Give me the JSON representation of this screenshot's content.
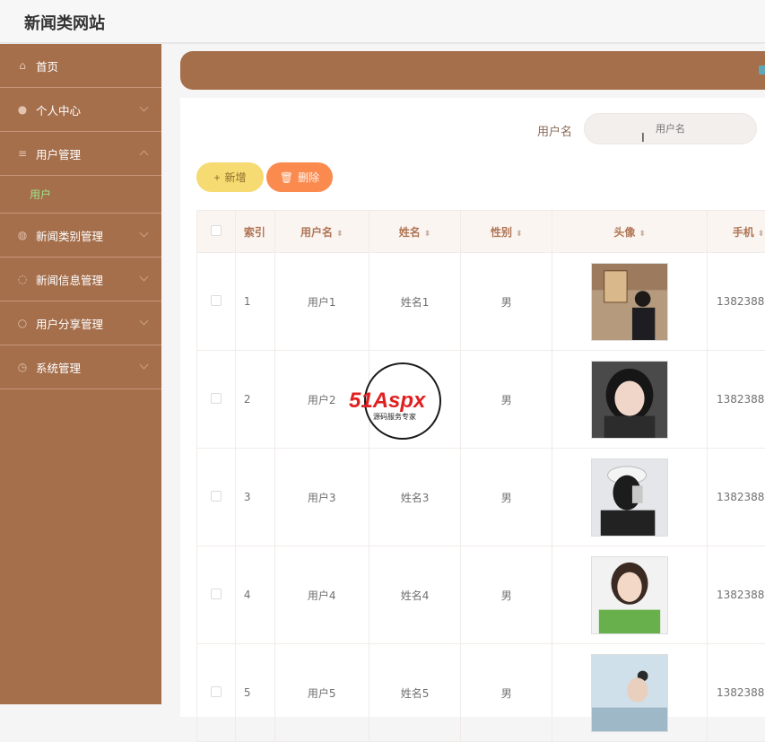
{
  "app": {
    "title": "新闻类网站"
  },
  "sidebar": {
    "items": [
      {
        "label": "首页",
        "icon": "home-icon"
      },
      {
        "label": "个人中心",
        "icon": "person-icon"
      },
      {
        "label": "用户管理",
        "icon": "list-icon"
      },
      {
        "label": "用户",
        "sub": true
      },
      {
        "label": "新闻类别管理",
        "icon": "globe-icon"
      },
      {
        "label": "新闻信息管理",
        "icon": "power-icon"
      },
      {
        "label": "用户分享管理",
        "icon": "circle-icon"
      },
      {
        "label": "系统管理",
        "icon": "clock-icon"
      }
    ]
  },
  "search": {
    "label": "用户名",
    "placeholder": "用户名"
  },
  "toolbar": {
    "add_label": "新增",
    "delete_label": "删除"
  },
  "table": {
    "headers": [
      "索引",
      "用户名",
      "姓名",
      "性别",
      "头像",
      "手机"
    ],
    "rows": [
      {
        "index": "1",
        "username": "用户1",
        "name": "姓名1",
        "gender": "男",
        "phone": "1382388"
      },
      {
        "index": "2",
        "username": "用户2",
        "name": "姓名2",
        "gender": "男",
        "phone": "1382388"
      },
      {
        "index": "3",
        "username": "用户3",
        "name": "姓名3",
        "gender": "男",
        "phone": "1382388"
      },
      {
        "index": "4",
        "username": "用户4",
        "name": "姓名4",
        "gender": "男",
        "phone": "1382388"
      },
      {
        "index": "5",
        "username": "用户5",
        "name": "姓名5",
        "gender": "男",
        "phone": "1382388"
      }
    ]
  },
  "watermark": {
    "brand": "51Aspx",
    "tagline": "源码服务专家"
  },
  "colors": {
    "sidebar": "#a56f4c",
    "accent_green": "#9ee28b",
    "add_button": "#f6da72",
    "delete_button": "#fb8a4f"
  }
}
